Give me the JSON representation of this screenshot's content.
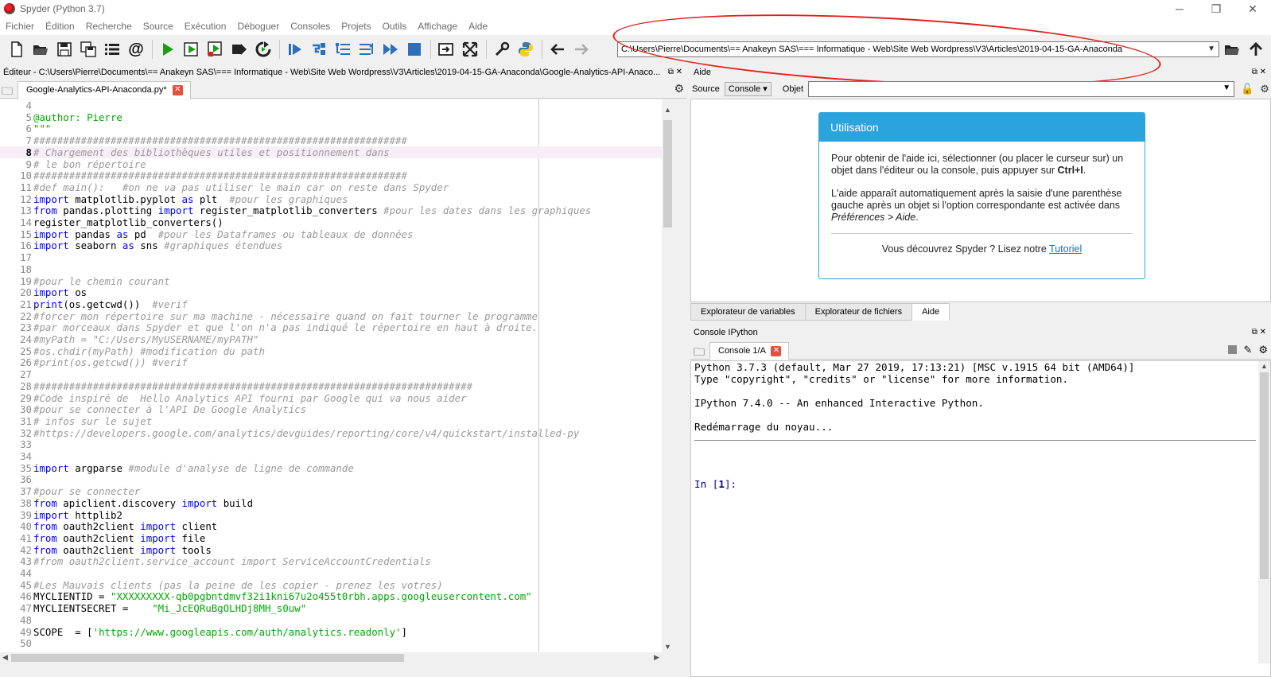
{
  "window": {
    "title": "Spyder (Python 3.7)"
  },
  "menu": [
    "Fichier",
    "Édition",
    "Recherche",
    "Source",
    "Exécution",
    "Déboguer",
    "Consoles",
    "Projets",
    "Outils",
    "Affichage",
    "Aide"
  ],
  "toolbar": {
    "path": "C:\\Users\\Pierre\\Documents\\== Anakeyn SAS\\=== Informatique - Web\\Site Web Wordpress\\V3\\Articles\\2019-04-15-GA-Anaconda",
    "at_label": "@"
  },
  "editor": {
    "title": "Éditeur - C:\\Users\\Pierre\\Documents\\== Anakeyn SAS\\=== Informatique - Web\\Site Web Wordpress\\V3\\Articles\\2019-04-15-GA-Anaconda\\Google-Analytics-API-Anaco...",
    "tab": "Google-Analytics-API-Anaconda.py*",
    "current_line": 8,
    "lines": [
      {
        "n": "4",
        "t": [
          [
            "plain",
            ""
          ]
        ]
      },
      {
        "n": "5",
        "t": [
          [
            "doc",
            "@author: Pierre"
          ]
        ]
      },
      {
        "n": "6",
        "t": [
          [
            "doc",
            "\"\"\""
          ]
        ]
      },
      {
        "n": "7",
        "t": [
          [
            "cm",
            "###############################################################"
          ]
        ]
      },
      {
        "n": "8",
        "t": [
          [
            "cmb",
            "# Chargement des bibliothèques utiles"
          ],
          [
            "cm",
            " et positionnement dans"
          ]
        ]
      },
      {
        "n": "9",
        "t": [
          [
            "cm",
            "# le bon répertoire"
          ]
        ]
      },
      {
        "n": "10",
        "t": [
          [
            "cm",
            "###############################################################"
          ]
        ]
      },
      {
        "n": "11",
        "t": [
          [
            "cm",
            "#def main():   #on ne va pas utiliser le main car on reste dans Spyder"
          ]
        ]
      },
      {
        "n": "12",
        "t": [
          [
            "kw",
            "import"
          ],
          [
            "plain",
            " matplotlib.pyplot "
          ],
          [
            "kw",
            "as"
          ],
          [
            "plain",
            " plt  "
          ],
          [
            "cm",
            "#pour les graphiques"
          ]
        ]
      },
      {
        "n": "13",
        "t": [
          [
            "kw",
            "from"
          ],
          [
            "plain",
            " pandas.plotting "
          ],
          [
            "kw",
            "import"
          ],
          [
            "plain",
            " register_matplotlib_converters "
          ],
          [
            "cm",
            "#pour les dates dans les graphiques"
          ]
        ]
      },
      {
        "n": "14",
        "t": [
          [
            "plain",
            "register_matplotlib_converters()"
          ]
        ]
      },
      {
        "n": "15",
        "t": [
          [
            "kw",
            "import"
          ],
          [
            "plain",
            " pandas "
          ],
          [
            "kw",
            "as"
          ],
          [
            "plain",
            " pd  "
          ],
          [
            "cm",
            "#pour les Dataframes ou tableaux de données"
          ]
        ]
      },
      {
        "n": "16",
        "t": [
          [
            "kw",
            "import"
          ],
          [
            "plain",
            " seaborn "
          ],
          [
            "kw",
            "as"
          ],
          [
            "plain",
            " sns "
          ],
          [
            "cm",
            "#graphiques étendues"
          ]
        ]
      },
      {
        "n": "17",
        "t": [
          [
            "plain",
            ""
          ]
        ]
      },
      {
        "n": "18",
        "t": [
          [
            "plain",
            ""
          ]
        ]
      },
      {
        "n": "19",
        "t": [
          [
            "cm",
            "#pour le chemin courant"
          ]
        ]
      },
      {
        "n": "20",
        "t": [
          [
            "kw",
            "import"
          ],
          [
            "plain",
            " os"
          ]
        ]
      },
      {
        "n": "21",
        "t": [
          [
            "kw",
            "print"
          ],
          [
            "plain",
            "(os.getcwd())  "
          ],
          [
            "cm",
            "#verif"
          ]
        ]
      },
      {
        "n": "22",
        "t": [
          [
            "cm",
            "#forcer mon répertoire sur ma machine - nécessaire quand on fait tourner le programme"
          ]
        ]
      },
      {
        "n": "23",
        "t": [
          [
            "cm",
            "#par morceaux dans Spyder et que l'on n'a pas indiqué le répertoire en haut à droite."
          ]
        ]
      },
      {
        "n": "24",
        "t": [
          [
            "cm",
            "#myPath = \"C:/Users/MyUSERNAME/myPATH\""
          ]
        ]
      },
      {
        "n": "25",
        "t": [
          [
            "cm",
            "#os.chdir(myPath) #modification du path"
          ]
        ]
      },
      {
        "n": "26",
        "t": [
          [
            "cm",
            "#print(os.getcwd()) #verif"
          ]
        ]
      },
      {
        "n": "27",
        "t": [
          [
            "plain",
            ""
          ]
        ]
      },
      {
        "n": "28",
        "t": [
          [
            "cm",
            "##########################################################################"
          ]
        ]
      },
      {
        "n": "29",
        "t": [
          [
            "cm",
            "#Code inspiré de  Hello Analytics API fourni par Google qui va nous aider"
          ]
        ]
      },
      {
        "n": "30",
        "t": [
          [
            "cm",
            "#pour se connecter à l'API De Google Analytics"
          ]
        ]
      },
      {
        "n": "31",
        "t": [
          [
            "cm",
            "# infos sur le sujet"
          ]
        ]
      },
      {
        "n": "32",
        "t": [
          [
            "cm",
            "#https://developers.google.com/analytics/devguides/reporting/core/v4/quickstart/installed-py"
          ]
        ]
      },
      {
        "n": "33",
        "t": [
          [
            "plain",
            ""
          ]
        ]
      },
      {
        "n": "34",
        "t": [
          [
            "plain",
            ""
          ]
        ]
      },
      {
        "n": "35",
        "t": [
          [
            "kw",
            "import"
          ],
          [
            "plain",
            " argparse "
          ],
          [
            "cm",
            "#module d'analyse de ligne de commande"
          ]
        ]
      },
      {
        "n": "36",
        "t": [
          [
            "plain",
            ""
          ]
        ]
      },
      {
        "n": "37",
        "t": [
          [
            "cm",
            "#pour se connecter"
          ]
        ]
      },
      {
        "n": "38",
        "t": [
          [
            "kw",
            "from"
          ],
          [
            "plain",
            " apiclient.discovery "
          ],
          [
            "kw",
            "import"
          ],
          [
            "plain",
            " build"
          ]
        ]
      },
      {
        "n": "39",
        "t": [
          [
            "kw",
            "import"
          ],
          [
            "plain",
            " httplib2"
          ]
        ]
      },
      {
        "n": "40",
        "t": [
          [
            "kw",
            "from"
          ],
          [
            "plain",
            " oauth2client "
          ],
          [
            "kw",
            "import"
          ],
          [
            "plain",
            " client"
          ]
        ]
      },
      {
        "n": "41",
        "t": [
          [
            "kw",
            "from"
          ],
          [
            "plain",
            " oauth2client "
          ],
          [
            "kw",
            "import"
          ],
          [
            "plain",
            " file"
          ]
        ]
      },
      {
        "n": "42",
        "t": [
          [
            "kw",
            "from"
          ],
          [
            "plain",
            " oauth2client "
          ],
          [
            "kw",
            "import"
          ],
          [
            "plain",
            " tools"
          ]
        ]
      },
      {
        "n": "43",
        "t": [
          [
            "cm",
            "#from oauth2client.service_account import ServiceAccountCredentials"
          ]
        ]
      },
      {
        "n": "44",
        "t": [
          [
            "plain",
            ""
          ]
        ]
      },
      {
        "n": "45",
        "t": [
          [
            "cm",
            "#Les Mauvais clients (pas la peine de les copier - prenez les votres)"
          ]
        ]
      },
      {
        "n": "46",
        "t": [
          [
            "plain",
            "MYCLIENTID = "
          ],
          [
            "str",
            "\"XXXXXXXXX-qb0pgbntdmvf32i1kni67u2o455t0rbh.apps.googleusercontent.com\""
          ]
        ]
      },
      {
        "n": "47",
        "t": [
          [
            "plain",
            "MYCLIENTSECRET =    "
          ],
          [
            "str",
            "\"Mi_JcEQRuBgOLHDj8MH_s0uw\""
          ]
        ]
      },
      {
        "n": "48",
        "t": [
          [
            "plain",
            ""
          ]
        ]
      },
      {
        "n": "49",
        "t": [
          [
            "plain",
            "SCOPE  = ["
          ],
          [
            "str",
            "'https://www.googleapis.com/auth/analytics.readonly'"
          ],
          [
            "plain",
            "]"
          ]
        ]
      },
      {
        "n": "50",
        "t": [
          [
            "plain",
            ""
          ]
        ]
      }
    ]
  },
  "help": {
    "title": "Aide",
    "source_label": "Source",
    "source_value": "Console",
    "object_label": "Objet",
    "card": {
      "header": "Utilisation",
      "p1_a": "Pour obtenir de l'aide ici, sélectionner (ou placer le curseur sur) un objet dans l'éditeur ou la console, puis appuyer sur ",
      "p1_key": "Ctrl+I",
      "p1_b": ".",
      "p2_a": "L'aide apparaît automatiquement après la saisie d'une parenthèse gauche après un objet si l'option correspondante est activée dans ",
      "p2_em": "Préférences > Aide",
      "p2_b": ".",
      "foot_text": "Vous découvrez Spyder ? Lisez notre ",
      "foot_link": "Tutoriel"
    }
  },
  "bottom_tabs": [
    "Explorateur de variables",
    "Explorateur de fichiers",
    "Aide"
  ],
  "console": {
    "title": "Console IPython",
    "tab": "Console 1/A",
    "lines": [
      "Python 3.7.3 (default, Mar 27 2019, 17:13:21) [MSC v.1915 64 bit (AMD64)]",
      "Type \"copyright\", \"credits\" or \"license\" for more information.",
      "",
      "IPython 7.4.0 -- An enhanced Interactive Python.",
      "",
      "Redémarrage du noyau..."
    ],
    "prompt_a": "In [",
    "prompt_n": "1",
    "prompt_b": "]:"
  }
}
